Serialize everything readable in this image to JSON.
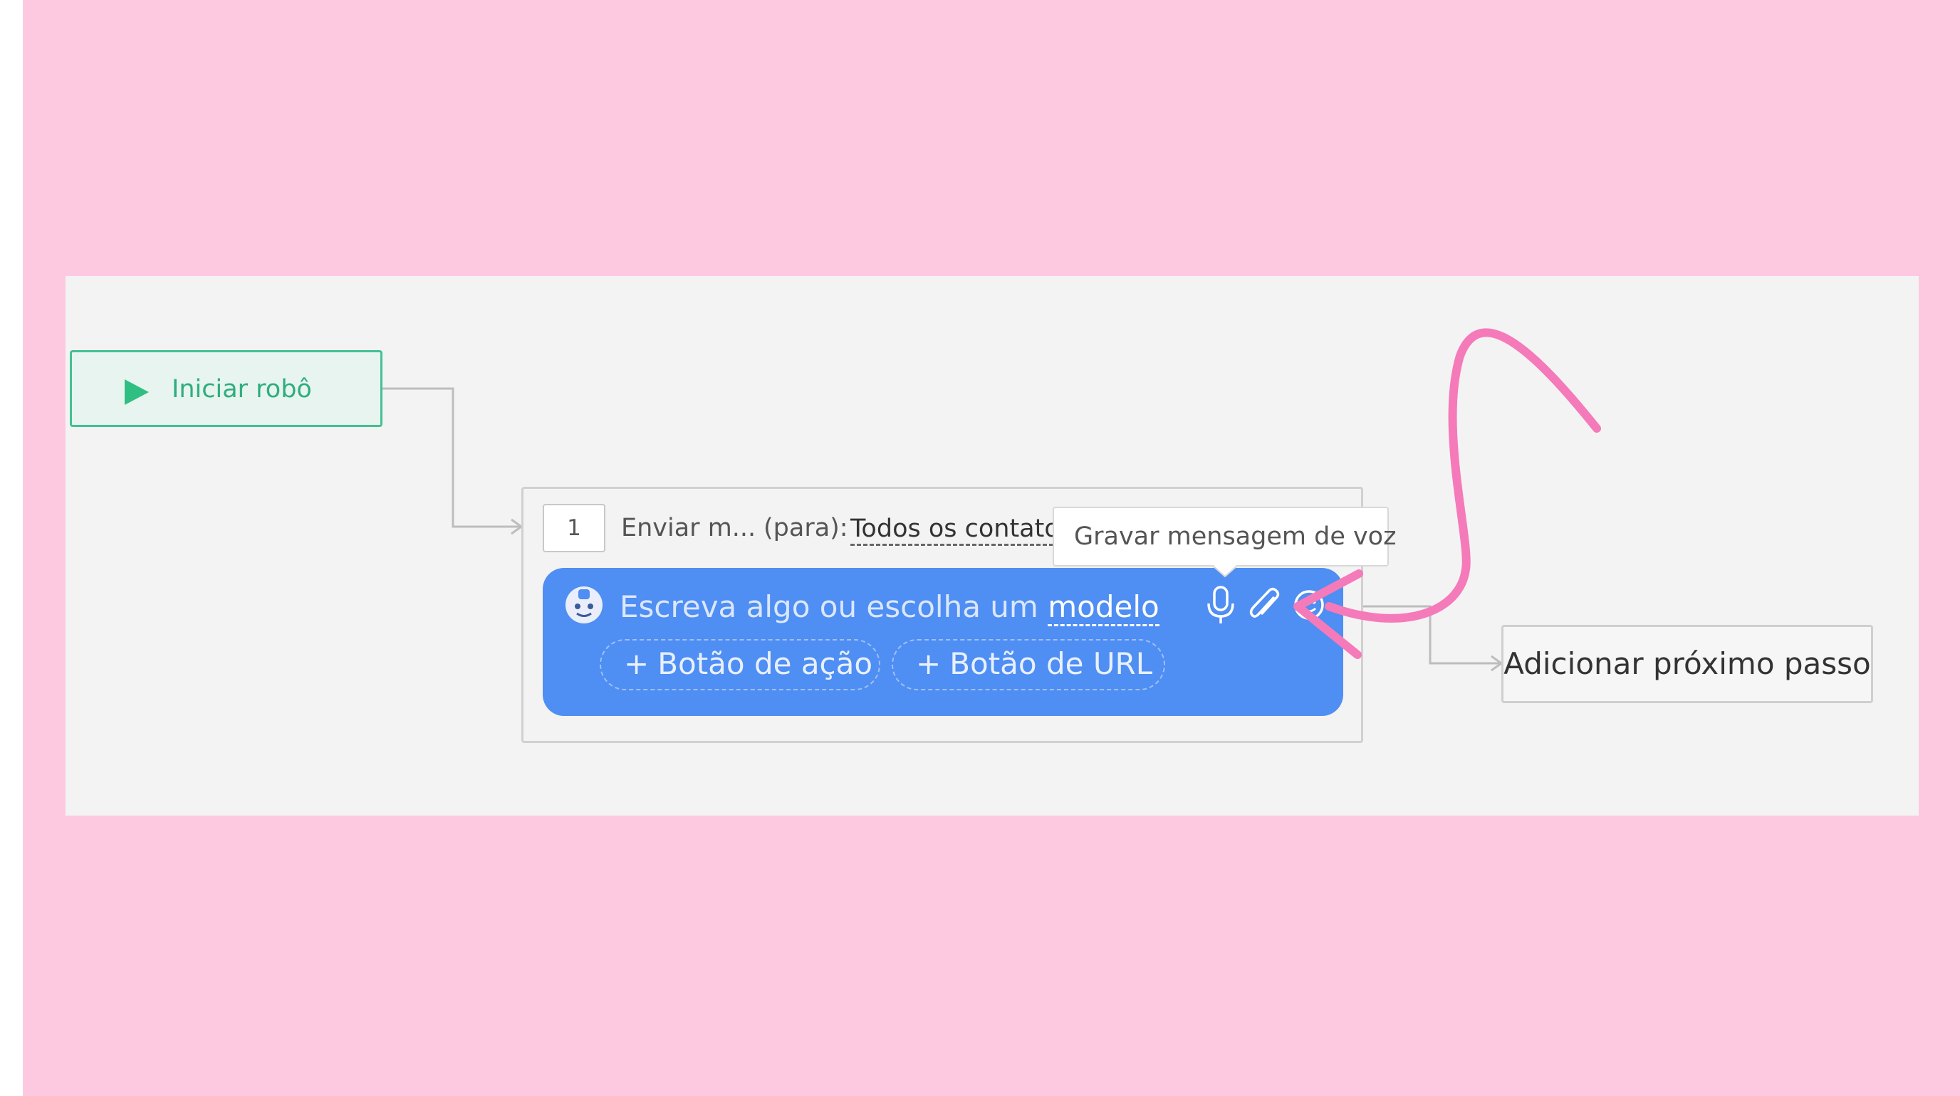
{
  "flow": {
    "start_node": {
      "label": "Iniciar robô",
      "icon": "play-icon"
    },
    "step": {
      "number": "1",
      "action_label": "Enviar m...",
      "to_label": "(para):",
      "recipients": "Todos os contatos",
      "message": {
        "placeholder": "Escreva algo ou escolha um",
        "template_link": "modelo",
        "buttons": [
          {
            "label": "Botão de ação",
            "icon": "plus-icon"
          },
          {
            "label": "Botão de URL",
            "icon": "plus-icon"
          }
        ],
        "toolbar_icons": [
          "microphone-icon",
          "paperclip-icon",
          "emoji-icon"
        ]
      }
    },
    "tooltip": "Gravar mensagem de voz",
    "next_step_label": "Adicionar próximo passo"
  },
  "colors": {
    "background": "#fdc9e1",
    "canvas": "#f3f3f3",
    "start_accent": "#43c192",
    "message_box": "#4f8ef3",
    "annotation": "#f57aba"
  }
}
